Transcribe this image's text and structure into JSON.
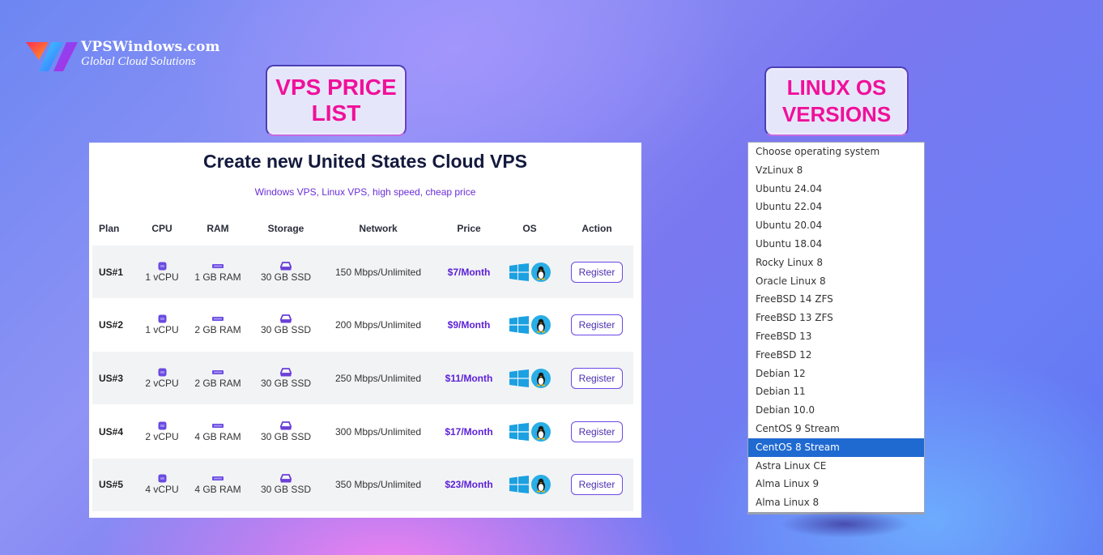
{
  "brand": {
    "name": "VPSWindows.com",
    "tagline": "Global Cloud Solutions"
  },
  "badges": {
    "price_list": "VPS PRICE LIST",
    "linux_versions": "LINUX OS VERSIONS"
  },
  "price_card": {
    "title": "Create new United States Cloud VPS",
    "subtitle": "Windows VPS, Linux VPS, high speed, cheap price",
    "columns": [
      "Plan",
      "CPU",
      "RAM",
      "Storage",
      "Network",
      "Price",
      "OS",
      "Action"
    ],
    "plans": [
      {
        "plan": "US#1",
        "cpu": "1 vCPU",
        "ram": "1 GB RAM",
        "storage": "30 GB SSD",
        "network": "150 Mbps/Unlimited",
        "price": "$7/Month",
        "os": [
          "windows-icon",
          "linux-tux-icon"
        ],
        "action": "Register"
      },
      {
        "plan": "US#2",
        "cpu": "1 vCPU",
        "ram": "2 GB RAM",
        "storage": "30 GB SSD",
        "network": "200 Mbps/Unlimited",
        "price": "$9/Month",
        "os": [
          "windows-icon",
          "linux-tux-icon"
        ],
        "action": "Register"
      },
      {
        "plan": "US#3",
        "cpu": "2 vCPU",
        "ram": "2 GB RAM",
        "storage": "30 GB SSD",
        "network": "250 Mbps/Unlimited",
        "price": "$11/Month",
        "os": [
          "windows-icon",
          "linux-tux-icon"
        ],
        "action": "Register"
      },
      {
        "plan": "US#4",
        "cpu": "2 vCPU",
        "ram": "4 GB RAM",
        "storage": "30 GB SSD",
        "network": "300 Mbps/Unlimited",
        "price": "$17/Month",
        "os": [
          "windows-icon",
          "linux-tux-icon"
        ],
        "action": "Register"
      },
      {
        "plan": "US#5",
        "cpu": "4 vCPU",
        "ram": "4 GB RAM",
        "storage": "30 GB SSD",
        "network": "350 Mbps/Unlimited",
        "price": "$23/Month",
        "os": [
          "windows-icon",
          "linux-tux-icon"
        ],
        "action": "Register"
      }
    ],
    "colors": {
      "price": "#5a1fd8",
      "accent": "#6d48e6",
      "windows": "#1ba1e2",
      "linux_bg": "#29aee6"
    }
  },
  "os_dropdown": {
    "options": [
      "Choose operating system",
      "VzLinux 8",
      "Ubuntu 24.04",
      "Ubuntu 22.04",
      "Ubuntu 20.04",
      "Ubuntu 18.04",
      "Rocky Linux 8",
      "Oracle Linux 8",
      "FreeBSD 14 ZFS",
      "FreeBSD 13 ZFS",
      "FreeBSD 13",
      "FreeBSD 12",
      "Debian 12",
      "Debian 11",
      "Debian 10.0",
      "CentOS 9 Stream",
      "CentOS 8 Stream",
      "Astra Linux CE",
      "Alma Linux 9",
      "Alma Linux 8"
    ],
    "selected": "CentOS 8 Stream",
    "selected_color": "#1f6ad1"
  }
}
